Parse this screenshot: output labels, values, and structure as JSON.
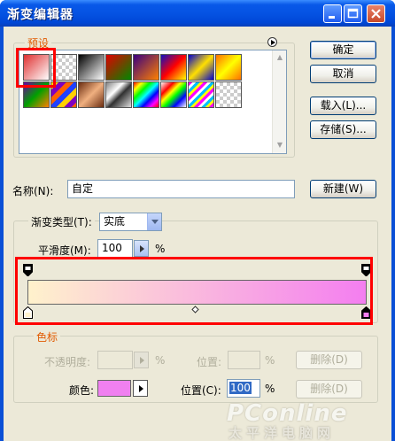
{
  "window": {
    "title": "渐变编辑器"
  },
  "presets": {
    "label": "预设",
    "swatches": [
      "red-transparent",
      "transparent",
      "black-white",
      "red-green",
      "violet-orange",
      "blue-red-yellow",
      "blue-yellow-blue",
      "orange-yellow-orange",
      "violet-green-orange",
      "yellow-violet-orange-blue",
      "copper",
      "chrome",
      "spectrum",
      "transparent-rainbow",
      "transparent-stripes",
      "transparent-checker"
    ]
  },
  "buttons": {
    "ok": "确定",
    "cancel": "取消",
    "load": "载入(L)...",
    "save": "存储(S)...",
    "new": "新建(W)"
  },
  "name_field": {
    "label": "名称(N):",
    "value": "自定"
  },
  "gradient_type": {
    "label": "渐变类型(T):",
    "value": "实底",
    "smoothness_label": "平滑度(M):",
    "smoothness_value": "100",
    "percent": "%"
  },
  "gradient": {
    "start_color": "#fff2cc",
    "end_color": "#f47ef0"
  },
  "color_stops": {
    "label": "色标",
    "opacity_label": "不透明度:",
    "opacity_percent": "%",
    "opacity_location_label": "位置:",
    "opacity_location_percent": "%",
    "delete_opacity": "删除(D)",
    "color_label": "颜色:",
    "color_value": "#f080f0",
    "location_label": "位置(C):",
    "location_value": "100",
    "location_percent": "%",
    "delete_color": "删除(D)"
  },
  "watermark": {
    "brand": "PConline",
    "sub": "太平洋电脑网"
  },
  "icons": {
    "minimize": "minimize-icon",
    "maximize": "maximize-icon",
    "close": "close-icon",
    "presets_menu": "circle-arrow-icon",
    "dropdown": "chevron-down-icon",
    "slider": "play-arrow-icon"
  }
}
